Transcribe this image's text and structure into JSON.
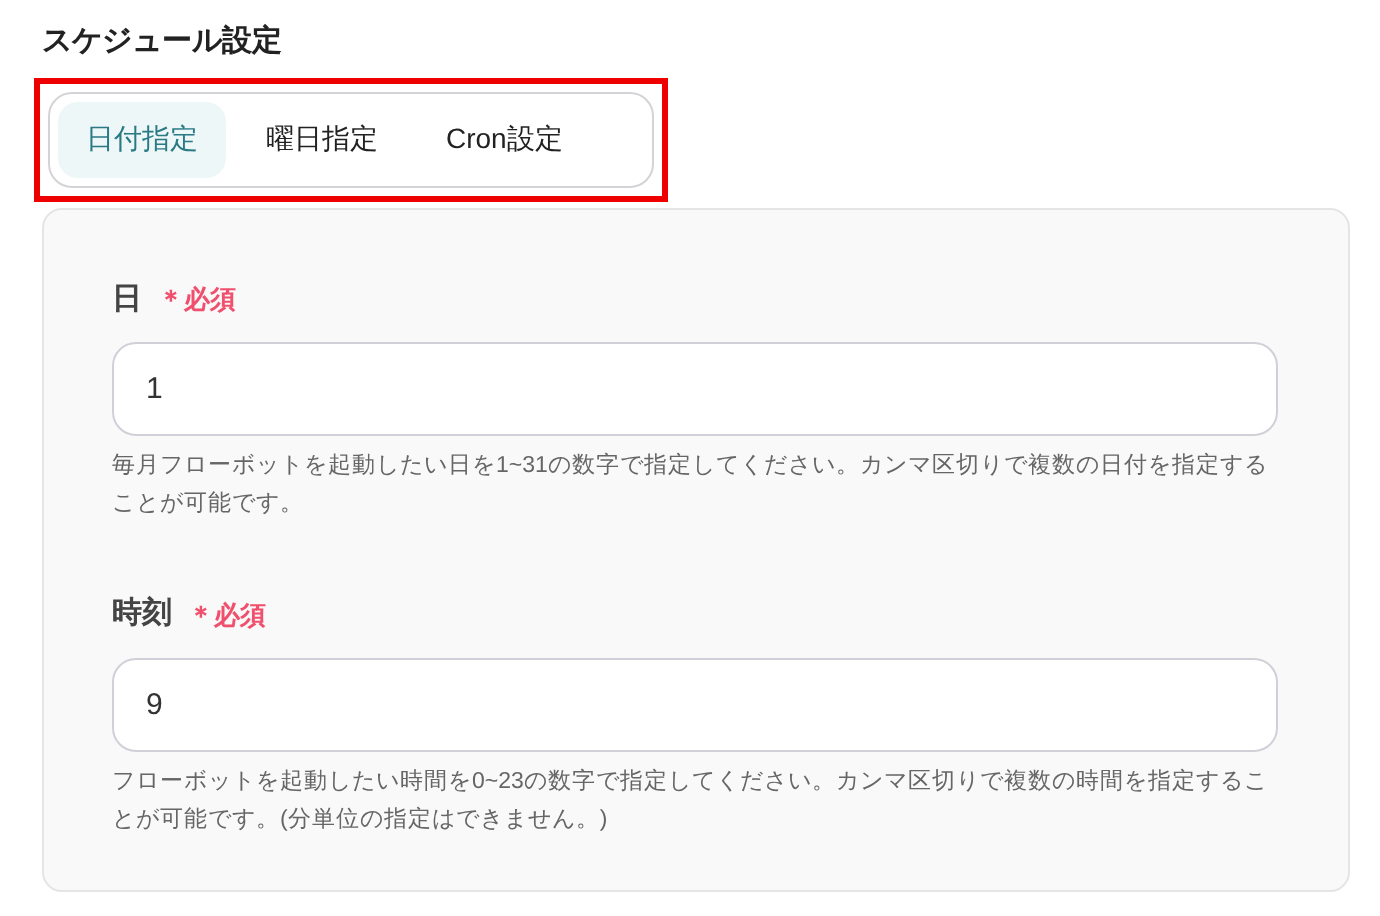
{
  "section_title": "スケジュール設定",
  "tabs": [
    {
      "label": "日付指定",
      "selected": true
    },
    {
      "label": "曜日指定",
      "selected": false
    },
    {
      "label": "Cron設定",
      "selected": false
    }
  ],
  "fields": [
    {
      "label": "日",
      "required": true,
      "required_text": "＊必須",
      "value": "1",
      "help": "毎月フローボットを起動したい日を1~31の数字で指定してください。カンマ区切りで複数の日付を指定することが可能です。"
    },
    {
      "label": "時刻",
      "required": true,
      "required_text": "＊必須",
      "value": "9",
      "help": "フローボットを起動したい時間を0~23の数字で指定してください。カンマ区切りで複数の時間を指定することが可能です。(分単位の指定はできません。)"
    }
  ]
}
